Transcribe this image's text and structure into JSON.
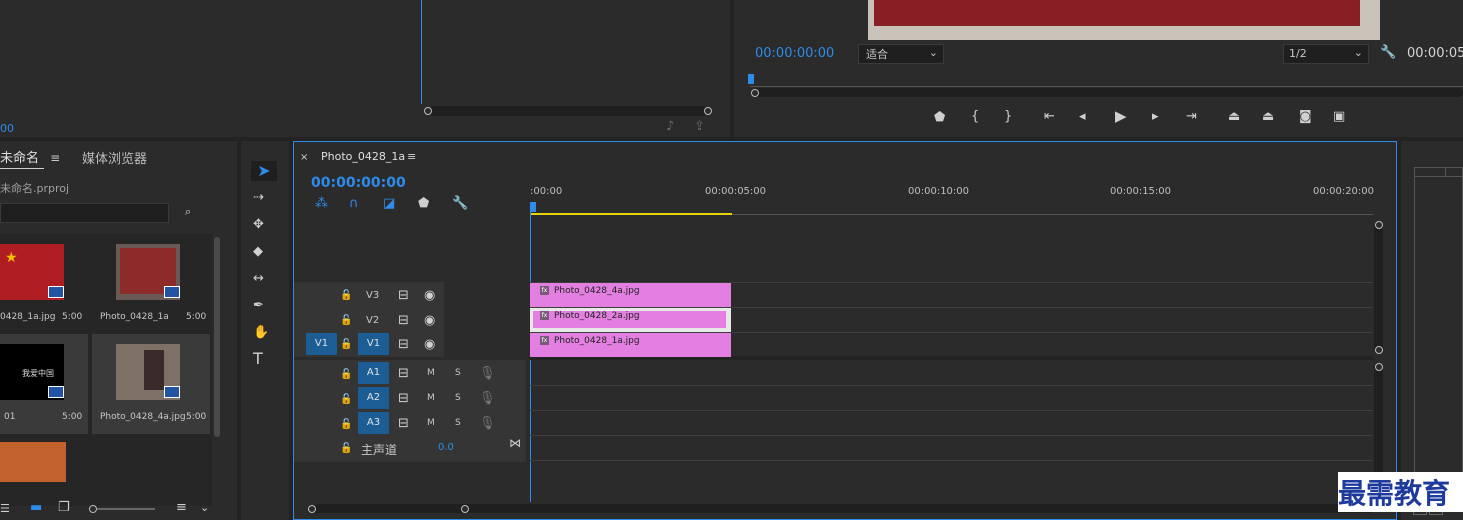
{
  "source_monitor": {
    "timecode": "00"
  },
  "program_monitor": {
    "timecode": "00:00:00:00",
    "fit_select": "适合",
    "quality_select": "1/2",
    "timecode_right": "00:00:05"
  },
  "project_panel": {
    "tab_project": "未命名",
    "tab_media_browser": "媒体浏览器",
    "project_file": "未命名.prproj",
    "items": [
      {
        "name": "0428_1a.jpg",
        "duration": "5:00"
      },
      {
        "name": "Photo_0428_1a",
        "duration": "5:00"
      },
      {
        "name": "01",
        "duration": "5:00",
        "title_text": "我爱中国"
      },
      {
        "name": "Photo_0428_4a.jpg",
        "duration": "5:00"
      }
    ]
  },
  "timeline": {
    "tab_title": "Photo_0428_1a",
    "timecode": "00:00:00:00",
    "ruler_labels": [
      ":00:00",
      "00:00:05:00",
      "00:00:10:00",
      "00:00:15:00",
      "00:00:20:00"
    ],
    "video_tracks": [
      "V3",
      "V2",
      "V1"
    ],
    "source_patch": "V1",
    "audio_tracks": [
      "A1",
      "A2",
      "A3"
    ],
    "mute_label": "M",
    "solo_label": "S",
    "master_label": "主声道",
    "master_value": "0.0",
    "clips": [
      {
        "track": "V3",
        "name": "Photo_0428_4a.jpg"
      },
      {
        "track": "V2",
        "name": "Photo_0428_2a.jpg"
      },
      {
        "track": "V1",
        "name": "Photo_0428_1a.jpg"
      }
    ]
  },
  "watermark": {
    "text": "最需教育"
  }
}
